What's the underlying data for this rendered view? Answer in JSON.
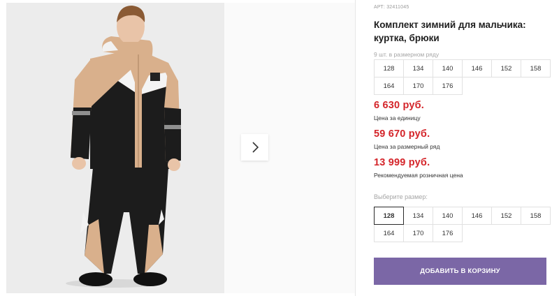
{
  "product": {
    "article": "АРТ: 32411045",
    "title": "Комплект зимний для мальчика: куртка, брюки"
  },
  "pack": {
    "label": "9 шт. в размерном ряду",
    "sizes": [
      "128",
      "134",
      "140",
      "146",
      "152",
      "158",
      "164",
      "170",
      "176"
    ]
  },
  "prices": [
    {
      "value": "6 630 руб.",
      "note": "Цена за единицу"
    },
    {
      "value": "59 670 руб.",
      "note": "Цена за размерный ряд"
    },
    {
      "value": "13 999 руб.",
      "note": "Рекомендуемая розничная цена"
    }
  ],
  "size_select": {
    "label": "Выберите размер:",
    "selected": "128",
    "options": [
      "128",
      "134",
      "140",
      "146",
      "152",
      "158",
      "164",
      "170",
      "176"
    ]
  },
  "cart_button": "ДОБАВИТЬ В КОРЗИНУ",
  "gallery": {
    "next_icon": "chevron-right-icon"
  },
  "colors": {
    "price": "#d4252a",
    "cart_button": "#7b67a6",
    "jacket_beige": "#d9b08c",
    "jacket_black": "#1c1c1c"
  }
}
